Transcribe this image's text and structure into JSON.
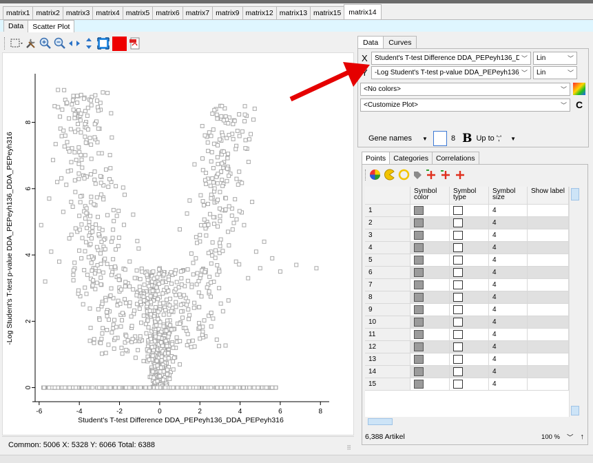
{
  "matrix_tabs": [
    "matrix1",
    "matrix2",
    "matrix3",
    "matrix4",
    "matrix5",
    "matrix6",
    "matrix7",
    "matrix9",
    "matrix12",
    "matrix13",
    "matrix15",
    "matrix14"
  ],
  "active_matrix_tab": "matrix14",
  "sub_tabs": [
    "Data",
    "Scatter Plot"
  ],
  "active_sub_tab": "Scatter Plot",
  "toolbar": {
    "icons": [
      "select-rectangle-icon",
      "tools-icon",
      "zoom-in-icon",
      "zoom-out-icon",
      "pan-horizontal-icon",
      "pan-vertical-icon",
      "fit-to-window-icon",
      "color-swatch-icon",
      "export-pdf-icon"
    ],
    "swatch_color": "#ee0000"
  },
  "plot": {
    "xlabel": "Student's T-test Difference DDA_PEPeyh136_DDA_PEPeyh316",
    "ylabel": "-Log Student's T-test p-value DDA_PEPeyh136_DDA_PEPeyh316",
    "x_ticks": [
      "-6",
      "-4",
      "-2",
      "0",
      "2",
      "4",
      "6",
      "8"
    ],
    "y_ticks": [
      "0",
      "2",
      "4",
      "6",
      "8"
    ],
    "point_color": "#a8a8a8"
  },
  "chart_data": {
    "type": "scatter",
    "title": "",
    "xlabel": "Student's T-test Difference DDA_PEPeyh136_DDA_PEPeyh316",
    "ylabel": "-Log Student's T-test p-value DDA_PEPeyh136_DDA_PEPeyh316",
    "xlim": [
      -6.2,
      8.3
    ],
    "ylim": [
      -0.3,
      9.3
    ],
    "grid": false,
    "legend": "none",
    "marker": "hollow-square",
    "point_count_shown": 6388,
    "series": [
      {
        "shape": "volcano",
        "x": [
          -5.9,
          -5.7,
          -5.5,
          -5.4,
          -5.1,
          -5.0,
          -4.8,
          -4.7,
          -4.5,
          -4.4,
          -4.3,
          -4.2,
          -4.1,
          -4.0,
          -3.9,
          -3.8,
          -3.7,
          -3.6,
          -3.5,
          -3.4,
          -3.3,
          -3.2,
          -3.1,
          -3.0,
          -2.9,
          -2.8,
          -2.7,
          -2.6,
          -2.5,
          -2.4,
          -2.3,
          -2.2,
          -2.1,
          -2.0,
          -1.9,
          -1.8,
          -1.6,
          -1.4,
          -1.2,
          -1.0,
          -0.8,
          -0.6,
          -0.4,
          -0.2,
          0.0,
          0.2,
          0.4,
          0.6,
          0.8,
          1.0,
          1.2,
          1.4,
          1.6,
          1.8,
          2.0,
          2.2,
          2.4,
          2.6,
          2.8,
          3.0,
          3.2,
          3.4,
          3.6,
          3.8,
          4.0,
          4.2,
          4.4,
          4.6,
          4.8,
          5.0,
          5.2,
          5.6,
          6.0,
          6.8,
          7.8
        ],
        "y": [
          4.9,
          3.2,
          5.7,
          4.1,
          6.2,
          3.8,
          5.3,
          7.6,
          4.5,
          6.8,
          3.4,
          5.9,
          4.7,
          7.1,
          3.9,
          6.4,
          5.1,
          8.2,
          4.3,
          6.9,
          3.6,
          5.5,
          7.4,
          4.8,
          3.1,
          6.1,
          2.7,
          5.2,
          2.3,
          4.4,
          1.9,
          3.6,
          1.5,
          2.9,
          1.2,
          2.2,
          1.1,
          1.8,
          0.9,
          1.4,
          0.8,
          1.1,
          1.7,
          2.9,
          3.6,
          2.2,
          1.4,
          0.9,
          1.2,
          0.7,
          1.8,
          2.6,
          3.1,
          3.9,
          4.6,
          5.5,
          6.3,
          7.1,
          8.4,
          5.9,
          6.8,
          4.7,
          5.4,
          3.8,
          6.2,
          4.9,
          3.3,
          5.6,
          4.1,
          3.6,
          4.4,
          3.9,
          3.5,
          3.7,
          3.6
        ]
      }
    ]
  },
  "status": "Common: 5006  X: 5328  Y: 6066  Total: 6388",
  "right_panel": {
    "tabs": [
      "Data",
      "Curves"
    ],
    "active_tab": "Data",
    "x_axis": {
      "letter": "X",
      "column": "Student's T-test Difference DDA_PEPeyh136_DDA_PEPeyh316",
      "scale": "Lin"
    },
    "y_axis": {
      "letter": "Y",
      "column": "-Log Student's T-test p-value DDA_PEPeyh136_DDA_PEPeyh316",
      "scale": "Lin"
    },
    "colors_select": "<No colors>",
    "customize_select": "<Customize Plot>",
    "label_column": "Gene names",
    "font_size": "8",
    "bold_label": "B",
    "split_option": "Up to ';'"
  },
  "points_panel": {
    "tabs": [
      "Points",
      "Categories",
      "Correlations"
    ],
    "active_tab": "Points",
    "columns": [
      "",
      "Symbol color",
      "Symbol type",
      "Symbol size",
      "Show label"
    ],
    "rows": [
      "1",
      "2",
      "3",
      "4",
      "5",
      "6",
      "7",
      "8",
      "9",
      "10",
      "11",
      "12",
      "13",
      "14",
      "15"
    ],
    "symbol_size": "4",
    "count": "6,388 Artikel",
    "zoom": "100 %"
  }
}
